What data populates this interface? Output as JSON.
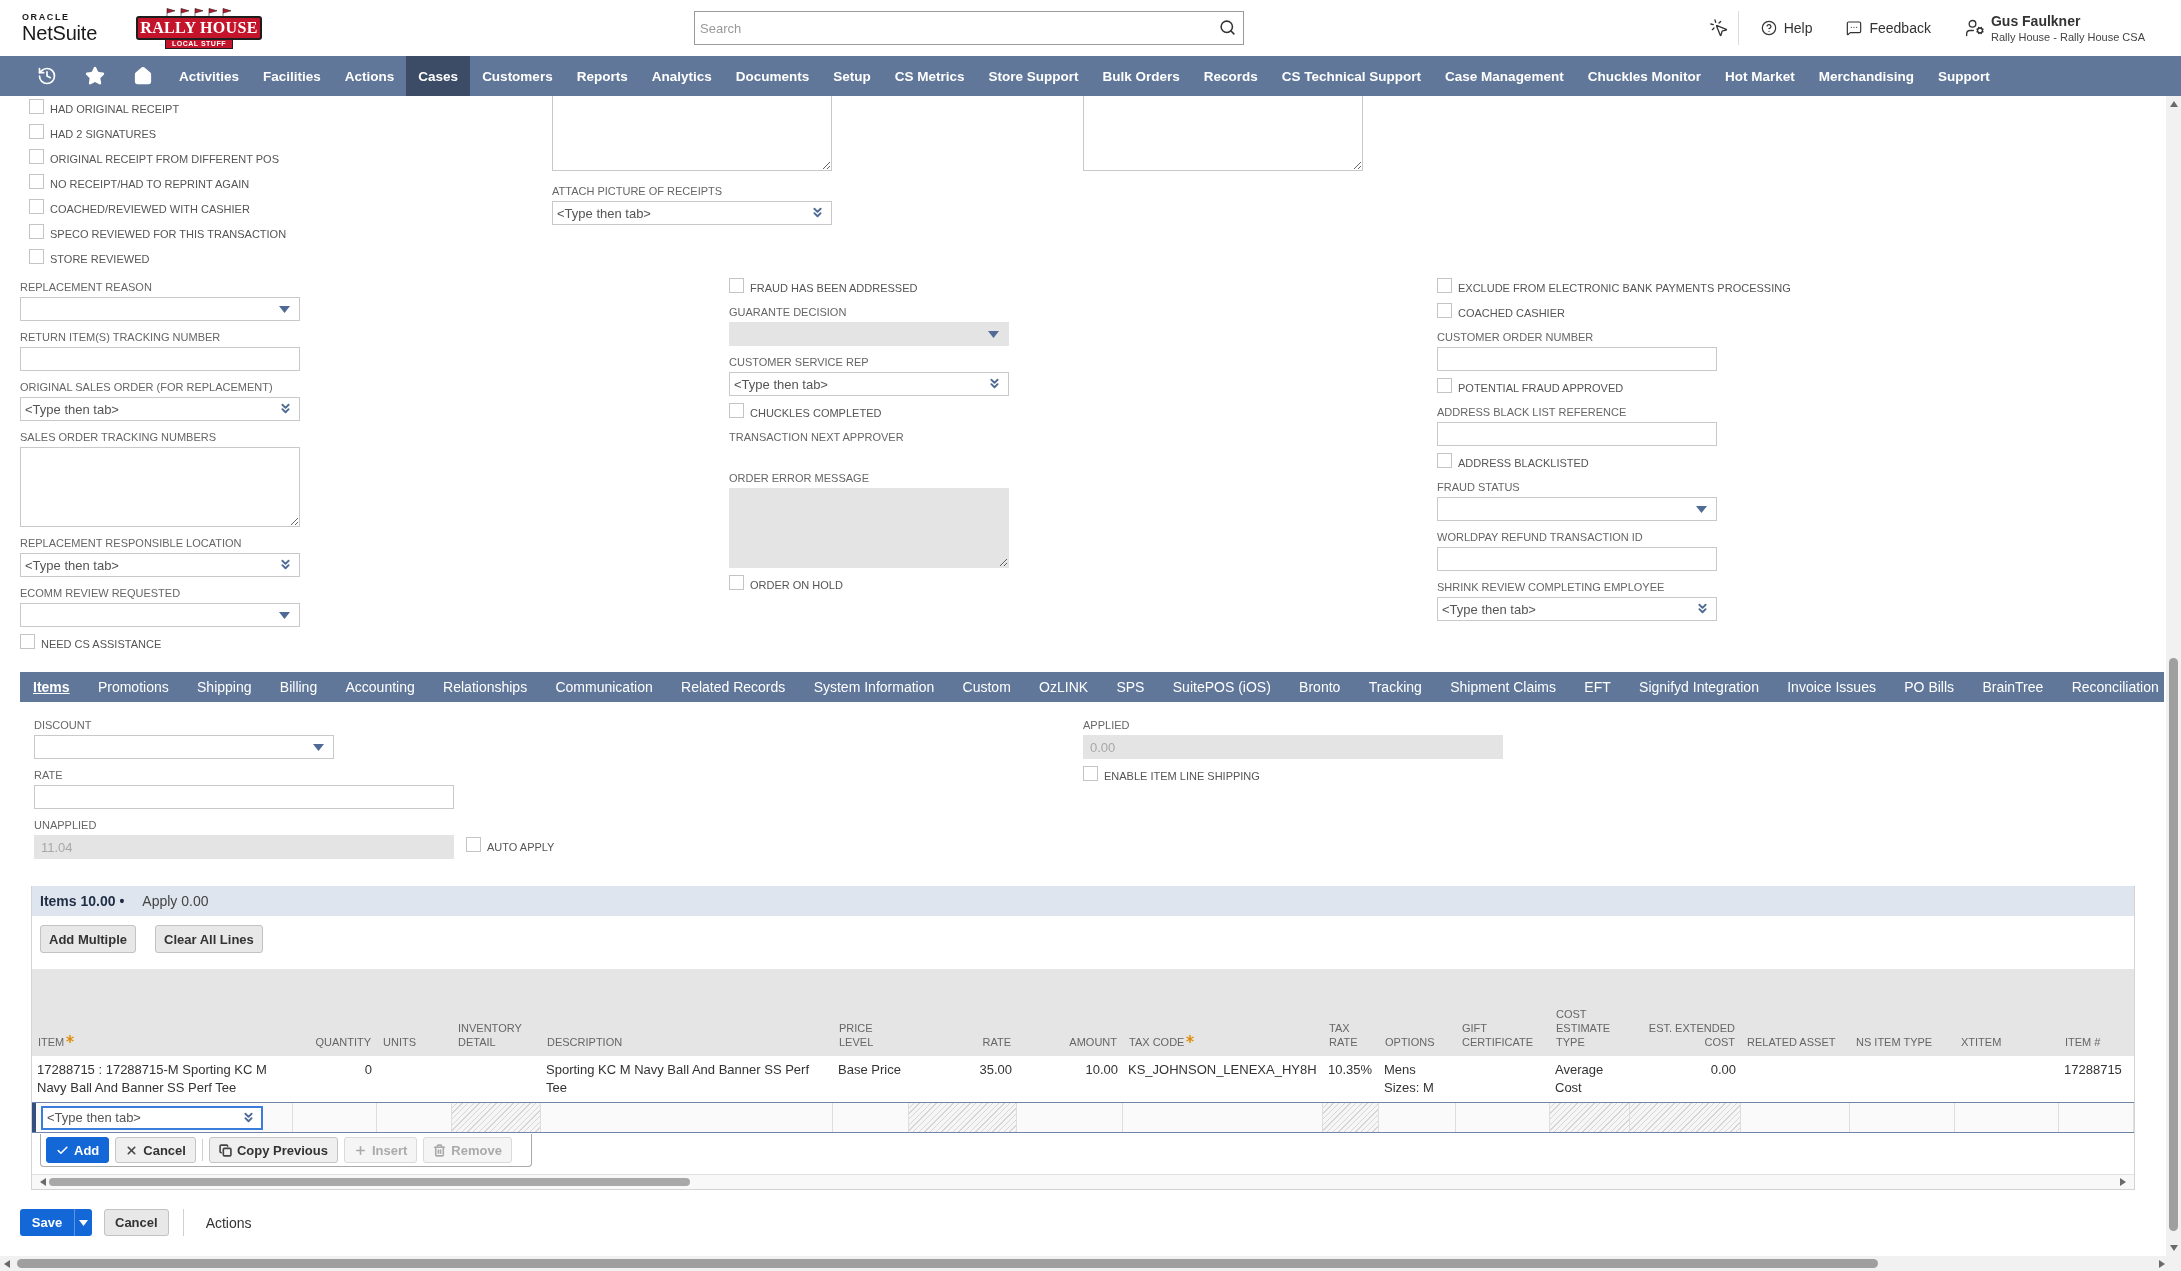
{
  "header": {
    "oracle": "ORACLE",
    "product": "NetSuite",
    "brand": {
      "title": "RALLY HOUSE",
      "tagline": "LOCAL STUFF"
    },
    "search": {
      "placeholder": "Search"
    },
    "links": [
      {
        "label": "Help",
        "kind": "help"
      },
      {
        "label": "Feedback",
        "kind": "feedback"
      }
    ],
    "user": {
      "name": "Gus Faulkner",
      "account": "Rally House - Rally House CSA"
    }
  },
  "nav": [
    {
      "label": "Activities",
      "selected": false
    },
    {
      "label": "Facilities",
      "selected": false
    },
    {
      "label": "Actions",
      "selected": false
    },
    {
      "label": "Cases",
      "selected": true
    },
    {
      "label": "Customers",
      "selected": false
    },
    {
      "label": "Reports",
      "selected": false
    },
    {
      "label": "Analytics",
      "selected": false
    },
    {
      "label": "Documents",
      "selected": false
    },
    {
      "label": "Setup",
      "selected": false
    },
    {
      "label": "CS Metrics",
      "selected": false
    },
    {
      "label": "Store Support",
      "selected": false
    },
    {
      "label": "Bulk Orders",
      "selected": false
    },
    {
      "label": "Records",
      "selected": false
    },
    {
      "label": "CS Technical Support",
      "selected": false
    },
    {
      "label": "Case Management",
      "selected": false
    },
    {
      "label": "Chuckles Monitor",
      "selected": false
    },
    {
      "label": "Hot Market",
      "selected": false
    },
    {
      "label": "Merchandising",
      "selected": false
    },
    {
      "label": "Support",
      "selected": false
    }
  ],
  "form": {
    "upper": [
      {
        "fields": [
          {
            "kind": "checkbox",
            "label": "HAD ORIGINAL RECEIPT",
            "checked": false
          },
          {
            "kind": "checkbox",
            "label": "HAD 2 SIGNATURES",
            "checked": false
          },
          {
            "kind": "checkbox",
            "label": "ORIGINAL RECEIPT FROM DIFFERENT POS",
            "checked": false
          },
          {
            "kind": "checkbox",
            "label": "NO RECEIPT/HAD TO REPRINT AGAIN",
            "checked": false
          },
          {
            "kind": "checkbox",
            "label": "COACHED/REVIEWED WITH CASHIER",
            "checked": false
          },
          {
            "kind": "checkbox",
            "label": "SPECO REVIEWED FOR THIS TRANSACTION",
            "checked": false
          },
          {
            "kind": "checkbox",
            "label": "STORE REVIEWED",
            "checked": false
          }
        ]
      },
      {
        "fields": [
          {
            "kind": "textarea",
            "disabled": false
          },
          {
            "kind": "lookup",
            "label": "ATTACH PICTURE OF RECEIPTS",
            "placeholder": "<Type then tab>"
          }
        ]
      },
      {
        "fields": [
          {
            "kind": "textarea",
            "disabled": false
          }
        ]
      }
    ],
    "lower": [
      {
        "fields": [
          {
            "kind": "select",
            "label": "REPLACEMENT REASON",
            "disabled": false
          },
          {
            "kind": "text",
            "label": "RETURN ITEM(S) TRACKING NUMBER",
            "disabled": false
          },
          {
            "kind": "lookup",
            "label": "ORIGINAL SALES ORDER (FOR REPLACEMENT)",
            "placeholder": "<Type then tab>"
          },
          {
            "kind": "textarea",
            "label": "SALES ORDER TRACKING NUMBERS",
            "disabled": false
          },
          {
            "kind": "lookup",
            "label": "REPLACEMENT RESPONSIBLE LOCATION",
            "placeholder": "<Type then tab>"
          },
          {
            "kind": "select",
            "label": "ECOMM REVIEW REQUESTED",
            "disabled": false
          },
          {
            "kind": "checkbox",
            "label": "NEED CS ASSISTANCE",
            "checked": false
          }
        ]
      },
      {
        "fields": [
          {
            "kind": "checkbox",
            "label": "FRAUD HAS BEEN ADDRESSED",
            "checked": false
          },
          {
            "kind": "select",
            "label": "GUARANTE DECISION",
            "disabled": true
          },
          {
            "kind": "lookup",
            "label": "CUSTOMER SERVICE REP",
            "placeholder": "<Type then tab>"
          },
          {
            "kind": "checkbox",
            "label": "CHUCKLES COMPLETED",
            "checked": false
          },
          {
            "kind": "display",
            "label": "TRANSACTION NEXT APPROVER"
          },
          {
            "kind": "textarea",
            "label": "ORDER ERROR MESSAGE",
            "disabled": true
          },
          {
            "kind": "checkbox",
            "label": "ORDER ON HOLD",
            "checked": false
          }
        ]
      },
      {
        "fields": [
          {
            "kind": "checkbox",
            "label": "EXCLUDE FROM ELECTRONIC BANK PAYMENTS PROCESSING",
            "checked": false
          },
          {
            "kind": "checkbox",
            "label": "COACHED CASHIER",
            "checked": false
          },
          {
            "kind": "text",
            "label": "CUSTOMER ORDER NUMBER",
            "disabled": false
          },
          {
            "kind": "checkbox",
            "label": "POTENTIAL FRAUD APPROVED",
            "checked": false
          },
          {
            "kind": "text",
            "label": "ADDRESS BLACK LIST REFERENCE",
            "disabled": false
          },
          {
            "kind": "checkbox",
            "label": "ADDRESS BLACKLISTED",
            "checked": false
          },
          {
            "kind": "select",
            "label": "FRAUD STATUS",
            "disabled": false
          },
          {
            "kind": "text",
            "label": "WORLDPAY REFUND TRANSACTION ID",
            "disabled": false
          },
          {
            "kind": "lookup",
            "label": "SHRINK REVIEW COMPLETING EMPLOYEE",
            "placeholder": "<Type then tab>"
          }
        ]
      }
    ]
  },
  "subtabs": [
    {
      "label": "Items",
      "selected": true
    },
    {
      "label": "Promotions",
      "selected": false
    },
    {
      "label": "Shipping",
      "selected": false
    },
    {
      "label": "Billing",
      "selected": false
    },
    {
      "label": "Accounting",
      "selected": false
    },
    {
      "label": "Relationships",
      "selected": false
    },
    {
      "label": "Communication",
      "selected": false
    },
    {
      "label": "Related Records",
      "selected": false
    },
    {
      "label": "System Information",
      "selected": false
    },
    {
      "label": "Custom",
      "selected": false
    },
    {
      "label": "OzLINK",
      "selected": false
    },
    {
      "label": "SPS",
      "selected": false
    },
    {
      "label": "SuitePOS (iOS)",
      "selected": false
    },
    {
      "label": "Bronto",
      "selected": false
    },
    {
      "label": "Tracking",
      "selected": false
    },
    {
      "label": "Shipment Claims",
      "selected": false
    },
    {
      "label": "EFT",
      "selected": false
    },
    {
      "label": "Signifyd Integration",
      "selected": false
    },
    {
      "label": "Invoice Issues",
      "selected": false
    },
    {
      "label": "PO Bills",
      "selected": false
    },
    {
      "label": "BrainTree",
      "selected": false
    },
    {
      "label": "Reconciliation",
      "selected": false
    }
  ],
  "items_tab": [
    {
      "fields": [
        {
          "kind": "select",
          "label": "DISCOUNT",
          "disabled": false
        },
        {
          "kind": "text",
          "label": "RATE",
          "disabled": false
        },
        {
          "kind": "text",
          "label": "UNAPPLIED",
          "value": "11.04",
          "disabled": true,
          "checkbox": {
            "label": "AUTO APPLY",
            "checked": false
          }
        }
      ]
    },
    {
      "fields": [
        {
          "kind": "text",
          "label": "APPLIED",
          "value": "0.00",
          "disabled": true
        },
        {
          "kind": "checkbox",
          "label": "ENABLE ITEM LINE SHIPPING",
          "checked": false
        }
      ]
    }
  ],
  "sublist": {
    "tabs": [
      {
        "label": "Items 10.00 •",
        "selected": true
      },
      {
        "label": "Apply 0.00",
        "selected": false
      }
    ],
    "buttons": [
      "Add Multiple",
      "Clear All Lines"
    ],
    "columns": [
      {
        "label": "ITEM",
        "kind": "text",
        "required": true
      },
      {
        "label": "QUANTITY",
        "kind": "number",
        "required": false
      },
      {
        "label": "UNITS",
        "kind": "text",
        "required": false
      },
      {
        "label": "INVENTORY DETAIL",
        "kind": "text",
        "required": false
      },
      {
        "label": "DESCRIPTION",
        "kind": "text",
        "required": false
      },
      {
        "label": "PRICE LEVEL",
        "kind": "text",
        "required": false
      },
      {
        "label": "RATE",
        "kind": "number",
        "required": false
      },
      {
        "label": "AMOUNT",
        "kind": "number",
        "required": false
      },
      {
        "label": "TAX CODE",
        "kind": "text",
        "required": true
      },
      {
        "label": "TAX RATE",
        "kind": "text",
        "required": false
      },
      {
        "label": "OPTIONS",
        "kind": "text",
        "required": false
      },
      {
        "label": "GIFT CERTIFICATE",
        "kind": "text",
        "required": false
      },
      {
        "label": "COST ESTIMATE TYPE",
        "kind": "text",
        "required": false
      },
      {
        "label": "EST. EXTENDED COST",
        "kind": "number",
        "required": false
      },
      {
        "label": "RELATED ASSET",
        "kind": "text",
        "required": false
      },
      {
        "label": "NS ITEM TYPE",
        "kind": "text",
        "required": false
      },
      {
        "label": "XTITEM",
        "kind": "text",
        "required": false
      },
      {
        "label": "ITEM #",
        "kind": "text",
        "required": false
      }
    ],
    "rows": [
      {
        "cells": [
          "17288715 : 17288715-M Sporting KC M Navy Ball And Banner SS Perf Tee",
          "0",
          null,
          null,
          "Sporting KC M Navy Ball And Banner SS Perf Tee",
          "Base Price",
          "35.00",
          "10.00",
          "KS_JOHNSON_LENEXA_HY8H",
          "10.35%",
          "Mens Sizes: M",
          null,
          "Average Cost",
          "0.00",
          null,
          null,
          null,
          "17288715"
        ]
      }
    ],
    "edit_row": {
      "placeholder": "<Type then tab>",
      "cells": [
        {
          "disabled": false
        },
        {
          "disabled": false
        },
        {
          "disabled": true
        },
        {
          "disabled": false
        },
        {
          "disabled": false
        },
        {
          "disabled": true
        },
        {
          "disabled": false
        },
        {
          "disabled": false
        },
        {
          "disabled": true
        },
        {
          "disabled": false
        },
        {
          "disabled": false
        },
        {
          "disabled": true
        },
        {
          "disabled": true
        },
        {
          "disabled": false
        },
        {
          "disabled": false
        },
        {
          "disabled": false
        },
        {
          "disabled": false
        }
      ]
    },
    "line_buttons": [
      {
        "label": "Add",
        "kind": "add",
        "disabled": false
      },
      {
        "label": "Cancel",
        "kind": "cancel",
        "disabled": false
      },
      {
        "label": "Copy Previous",
        "kind": "copy",
        "disabled": false
      },
      {
        "label": "Insert",
        "kind": "insert",
        "disabled": true
      },
      {
        "label": "Remove",
        "kind": "remove",
        "disabled": true
      }
    ]
  },
  "footer": {
    "save": "Save",
    "cancel": "Cancel",
    "actions": "Actions"
  }
}
